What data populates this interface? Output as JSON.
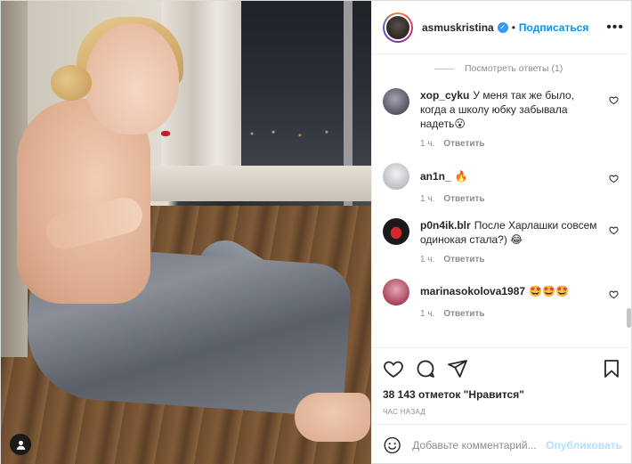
{
  "header": {
    "username": "asmuskristina",
    "verified_icon": "verified-badge-icon",
    "separator": "•",
    "follow_label": "Подписаться",
    "more_icon": "more-options-icon"
  },
  "view_replies": "Посмотреть ответы (1)",
  "comments": [
    {
      "user": "xop_cyku",
      "text": "У меня так же было, когда а школу юбку забывала надеть😮",
      "time": "1 ч.",
      "reply": "Ответить",
      "avatar_color": "#6b6a78"
    },
    {
      "user": "an1n_",
      "text": "🔥",
      "time": "1 ч.",
      "reply": "Ответить",
      "avatar_color": "#dfe0e3"
    },
    {
      "user": "p0n4ik.blr",
      "text": "После Харлашки совсем одинокая стала?) 😂",
      "time": "1 ч.",
      "reply": "Ответить",
      "avatar_color": "#1a1a1a"
    },
    {
      "user": "marinasokolova1987",
      "text": "🤩🤩🤩",
      "time": "1 ч.",
      "reply": "Ответить",
      "avatar_color": "#b9506a"
    }
  ],
  "actions": {
    "like_icon": "heart-icon",
    "comment_icon": "comment-icon",
    "share_icon": "share-icon",
    "save_icon": "bookmark-icon"
  },
  "likes": "38 143 отметок \"Нравится\"",
  "time_ago": "ЧАС НАЗАД",
  "add_comment": {
    "placeholder": "Добавьте комментарий...",
    "publish_label": "Опубликовать",
    "emoji_icon": "emoji-icon"
  },
  "colors": {
    "accent": "#0095f6",
    "publish_disabled": "#b2dffc",
    "muted": "#8e8e8e"
  }
}
